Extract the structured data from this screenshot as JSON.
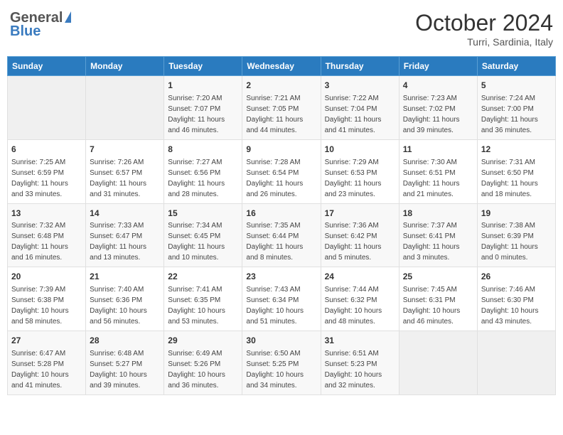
{
  "header": {
    "logo_general": "General",
    "logo_blue": "Blue",
    "month_title": "October 2024",
    "subtitle": "Turri, Sardinia, Italy"
  },
  "days_of_week": [
    "Sunday",
    "Monday",
    "Tuesday",
    "Wednesday",
    "Thursday",
    "Friday",
    "Saturday"
  ],
  "weeks": [
    [
      {
        "day": "",
        "sunrise": "",
        "sunset": "",
        "daylight": ""
      },
      {
        "day": "",
        "sunrise": "",
        "sunset": "",
        "daylight": ""
      },
      {
        "day": "1",
        "sunrise": "Sunrise: 7:20 AM",
        "sunset": "Sunset: 7:07 PM",
        "daylight": "Daylight: 11 hours and 46 minutes."
      },
      {
        "day": "2",
        "sunrise": "Sunrise: 7:21 AM",
        "sunset": "Sunset: 7:05 PM",
        "daylight": "Daylight: 11 hours and 44 minutes."
      },
      {
        "day": "3",
        "sunrise": "Sunrise: 7:22 AM",
        "sunset": "Sunset: 7:04 PM",
        "daylight": "Daylight: 11 hours and 41 minutes."
      },
      {
        "day": "4",
        "sunrise": "Sunrise: 7:23 AM",
        "sunset": "Sunset: 7:02 PM",
        "daylight": "Daylight: 11 hours and 39 minutes."
      },
      {
        "day": "5",
        "sunrise": "Sunrise: 7:24 AM",
        "sunset": "Sunset: 7:00 PM",
        "daylight": "Daylight: 11 hours and 36 minutes."
      }
    ],
    [
      {
        "day": "6",
        "sunrise": "Sunrise: 7:25 AM",
        "sunset": "Sunset: 6:59 PM",
        "daylight": "Daylight: 11 hours and 33 minutes."
      },
      {
        "day": "7",
        "sunrise": "Sunrise: 7:26 AM",
        "sunset": "Sunset: 6:57 PM",
        "daylight": "Daylight: 11 hours and 31 minutes."
      },
      {
        "day": "8",
        "sunrise": "Sunrise: 7:27 AM",
        "sunset": "Sunset: 6:56 PM",
        "daylight": "Daylight: 11 hours and 28 minutes."
      },
      {
        "day": "9",
        "sunrise": "Sunrise: 7:28 AM",
        "sunset": "Sunset: 6:54 PM",
        "daylight": "Daylight: 11 hours and 26 minutes."
      },
      {
        "day": "10",
        "sunrise": "Sunrise: 7:29 AM",
        "sunset": "Sunset: 6:53 PM",
        "daylight": "Daylight: 11 hours and 23 minutes."
      },
      {
        "day": "11",
        "sunrise": "Sunrise: 7:30 AM",
        "sunset": "Sunset: 6:51 PM",
        "daylight": "Daylight: 11 hours and 21 minutes."
      },
      {
        "day": "12",
        "sunrise": "Sunrise: 7:31 AM",
        "sunset": "Sunset: 6:50 PM",
        "daylight": "Daylight: 11 hours and 18 minutes."
      }
    ],
    [
      {
        "day": "13",
        "sunrise": "Sunrise: 7:32 AM",
        "sunset": "Sunset: 6:48 PM",
        "daylight": "Daylight: 11 hours and 16 minutes."
      },
      {
        "day": "14",
        "sunrise": "Sunrise: 7:33 AM",
        "sunset": "Sunset: 6:47 PM",
        "daylight": "Daylight: 11 hours and 13 minutes."
      },
      {
        "day": "15",
        "sunrise": "Sunrise: 7:34 AM",
        "sunset": "Sunset: 6:45 PM",
        "daylight": "Daylight: 11 hours and 10 minutes."
      },
      {
        "day": "16",
        "sunrise": "Sunrise: 7:35 AM",
        "sunset": "Sunset: 6:44 PM",
        "daylight": "Daylight: 11 hours and 8 minutes."
      },
      {
        "day": "17",
        "sunrise": "Sunrise: 7:36 AM",
        "sunset": "Sunset: 6:42 PM",
        "daylight": "Daylight: 11 hours and 5 minutes."
      },
      {
        "day": "18",
        "sunrise": "Sunrise: 7:37 AM",
        "sunset": "Sunset: 6:41 PM",
        "daylight": "Daylight: 11 hours and 3 minutes."
      },
      {
        "day": "19",
        "sunrise": "Sunrise: 7:38 AM",
        "sunset": "Sunset: 6:39 PM",
        "daylight": "Daylight: 11 hours and 0 minutes."
      }
    ],
    [
      {
        "day": "20",
        "sunrise": "Sunrise: 7:39 AM",
        "sunset": "Sunset: 6:38 PM",
        "daylight": "Daylight: 10 hours and 58 minutes."
      },
      {
        "day": "21",
        "sunrise": "Sunrise: 7:40 AM",
        "sunset": "Sunset: 6:36 PM",
        "daylight": "Daylight: 10 hours and 56 minutes."
      },
      {
        "day": "22",
        "sunrise": "Sunrise: 7:41 AM",
        "sunset": "Sunset: 6:35 PM",
        "daylight": "Daylight: 10 hours and 53 minutes."
      },
      {
        "day": "23",
        "sunrise": "Sunrise: 7:43 AM",
        "sunset": "Sunset: 6:34 PM",
        "daylight": "Daylight: 10 hours and 51 minutes."
      },
      {
        "day": "24",
        "sunrise": "Sunrise: 7:44 AM",
        "sunset": "Sunset: 6:32 PM",
        "daylight": "Daylight: 10 hours and 48 minutes."
      },
      {
        "day": "25",
        "sunrise": "Sunrise: 7:45 AM",
        "sunset": "Sunset: 6:31 PM",
        "daylight": "Daylight: 10 hours and 46 minutes."
      },
      {
        "day": "26",
        "sunrise": "Sunrise: 7:46 AM",
        "sunset": "Sunset: 6:30 PM",
        "daylight": "Daylight: 10 hours and 43 minutes."
      }
    ],
    [
      {
        "day": "27",
        "sunrise": "Sunrise: 6:47 AM",
        "sunset": "Sunset: 5:28 PM",
        "daylight": "Daylight: 10 hours and 41 minutes."
      },
      {
        "day": "28",
        "sunrise": "Sunrise: 6:48 AM",
        "sunset": "Sunset: 5:27 PM",
        "daylight": "Daylight: 10 hours and 39 minutes."
      },
      {
        "day": "29",
        "sunrise": "Sunrise: 6:49 AM",
        "sunset": "Sunset: 5:26 PM",
        "daylight": "Daylight: 10 hours and 36 minutes."
      },
      {
        "day": "30",
        "sunrise": "Sunrise: 6:50 AM",
        "sunset": "Sunset: 5:25 PM",
        "daylight": "Daylight: 10 hours and 34 minutes."
      },
      {
        "day": "31",
        "sunrise": "Sunrise: 6:51 AM",
        "sunset": "Sunset: 5:23 PM",
        "daylight": "Daylight: 10 hours and 32 minutes."
      },
      {
        "day": "",
        "sunrise": "",
        "sunset": "",
        "daylight": ""
      },
      {
        "day": "",
        "sunrise": "",
        "sunset": "",
        "daylight": ""
      }
    ]
  ]
}
